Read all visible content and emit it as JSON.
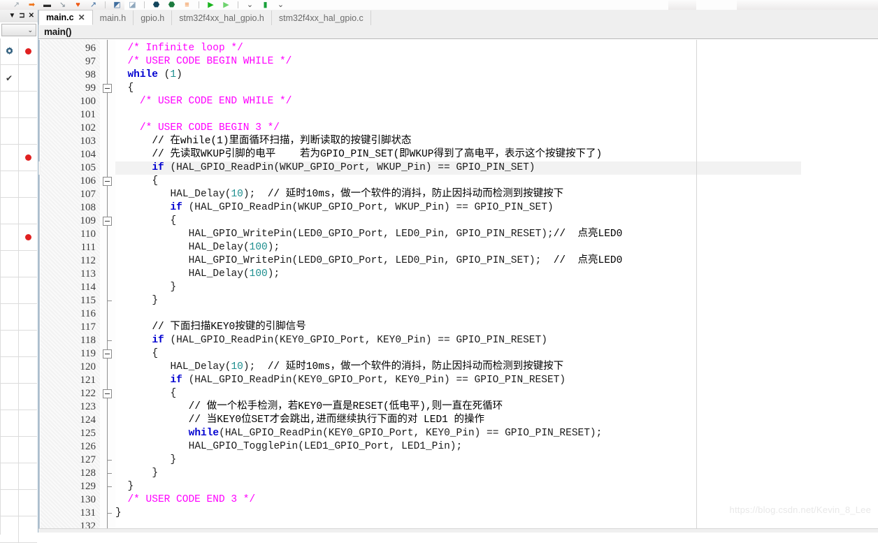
{
  "toolbar": {
    "icons": [
      {
        "name": "arrow-up-right-icon",
        "glyph": "↗",
        "color": "#9aa5ad"
      },
      {
        "name": "arrow-right-orange-icon",
        "glyph": "➡",
        "color": "#ef7216"
      },
      {
        "name": "step-over-icon",
        "glyph": "▬",
        "color": "#2b2b2b"
      },
      {
        "name": "arrow-down-left-icon",
        "glyph": "↘",
        "color": "#7d8a93"
      },
      {
        "name": "heart-orange-icon",
        "glyph": "♥",
        "color": "#ef5a16"
      },
      {
        "name": "arrow-up-right-blue-icon",
        "glyph": "↗",
        "color": "#3f6d9e"
      },
      {
        "name": "bookmark-box-icon",
        "glyph": "◩",
        "color": "#3f6d9e"
      },
      {
        "name": "bookmark-box2-icon",
        "glyph": "◪",
        "color": "#8fa7bd"
      },
      {
        "name": "shield-dark-icon",
        "glyph": "⬣",
        "color": "#12455c"
      },
      {
        "name": "shield-green-icon",
        "glyph": "⬣",
        "color": "#1b7a3e"
      },
      {
        "name": "list-orange-icon",
        "glyph": "≡",
        "color": "#ef7216"
      },
      {
        "name": "run-green-icon",
        "glyph": "▶",
        "color": "#18b31c"
      },
      {
        "name": "run-light-icon",
        "glyph": "▶",
        "color": "#6fd36f"
      },
      {
        "name": "overflow-chevron-icon",
        "glyph": "⌄",
        "color": "#4a4a4a"
      },
      {
        "name": "memory-green-icon",
        "glyph": "▮",
        "color": "#18a03a"
      },
      {
        "name": "overflow-chevron2-icon",
        "glyph": "⌄",
        "color": "#4a4a4a"
      }
    ]
  },
  "left_panel": {
    "header_buttons": [
      {
        "name": "panel-menu-icon",
        "glyph": "▼"
      },
      {
        "name": "panel-pin-icon",
        "glyph": "⊐"
      },
      {
        "name": "panel-close-icon",
        "glyph": "✕"
      }
    ],
    "dropdown": {
      "value": "",
      "chevron": "⌄"
    },
    "rows": [
      {
        "col1": "gear-icon",
        "col2": "breakpoint-dot"
      },
      {
        "col1": "check-icon",
        "col2": ""
      },
      {
        "col1": "",
        "col2": ""
      },
      {
        "col1": "",
        "col2": ""
      },
      {
        "col1": "",
        "col2": "breakpoint-dot"
      },
      {
        "col1": "",
        "col2": ""
      },
      {
        "col1": "",
        "col2": ""
      },
      {
        "col1": "",
        "col2": "breakpoint-dot"
      },
      {
        "col1": "",
        "col2": ""
      },
      {
        "col1": "",
        "col2": ""
      },
      {
        "col1": "",
        "col2": ""
      },
      {
        "col1": "",
        "col2": ""
      },
      {
        "col1": "",
        "col2": ""
      },
      {
        "col1": "",
        "col2": ""
      },
      {
        "col1": "",
        "col2": ""
      },
      {
        "col1": "",
        "col2": ""
      },
      {
        "col1": "",
        "col2": ""
      },
      {
        "col1": "",
        "col2": ""
      },
      {
        "col1": "",
        "col2": ""
      }
    ]
  },
  "tabs": [
    {
      "label": "main.c",
      "active": true,
      "close": "✕"
    },
    {
      "label": "main.h",
      "active": false
    },
    {
      "label": "gpio.h",
      "active": false
    },
    {
      "label": "stm32f4xx_hal_gpio.h",
      "active": false
    },
    {
      "label": "stm32f4xx_hal_gpio.c",
      "active": false
    }
  ],
  "scope": {
    "function": "main()"
  },
  "editor": {
    "first_line": 96,
    "current_line": 105,
    "fold_lines": [
      99,
      106,
      109,
      119,
      122
    ],
    "fold_ticks": [
      115,
      118,
      127,
      128,
      129,
      131
    ],
    "lines": [
      {
        "n": 96,
        "indent": 2,
        "tokens": [
          {
            "t": "/* Infinite loop */",
            "c": "cm"
          }
        ]
      },
      {
        "n": 97,
        "indent": 2,
        "tokens": [
          {
            "t": "/* USER CODE BEGIN WHILE */",
            "c": "cm"
          }
        ]
      },
      {
        "n": 98,
        "indent": 2,
        "tokens": [
          {
            "t": "while",
            "c": "kw"
          },
          {
            "t": " (",
            "c": "pn"
          },
          {
            "t": "1",
            "c": "num"
          },
          {
            "t": ")",
            "c": "pn"
          }
        ]
      },
      {
        "n": 99,
        "indent": 2,
        "tokens": [
          {
            "t": "{",
            "c": "pn"
          }
        ]
      },
      {
        "n": 100,
        "indent": 4,
        "tokens": [
          {
            "t": "/* USER CODE END WHILE */",
            "c": "cm"
          }
        ]
      },
      {
        "n": 101,
        "indent": 0,
        "tokens": []
      },
      {
        "n": 102,
        "indent": 4,
        "tokens": [
          {
            "t": "/* USER CODE BEGIN 3 */",
            "c": "cm"
          }
        ]
      },
      {
        "n": 103,
        "indent": 6,
        "tokens": [
          {
            "t": "// 在while(1)里面循环扫描，判断读取的按键引脚状态",
            "c": "cg"
          }
        ]
      },
      {
        "n": 104,
        "indent": 6,
        "tokens": [
          {
            "t": "// 先读取WKUP引脚的电平    若为GPIO_PIN_SET(即WKUP得到了高电平，表示这个按键按下了)",
            "c": "cg"
          }
        ]
      },
      {
        "n": 105,
        "indent": 6,
        "tokens": [
          {
            "t": "if",
            "c": "kw"
          },
          {
            "t": " (HAL_GPIO_ReadPin(WKUP_GPIO_Port, WKUP_Pin) == GPIO_PIN_SET)",
            "c": "id"
          }
        ]
      },
      {
        "n": 106,
        "indent": 6,
        "tokens": [
          {
            "t": "{",
            "c": "pn"
          }
        ]
      },
      {
        "n": 107,
        "indent": 9,
        "tokens": [
          {
            "t": "HAL_Delay(",
            "c": "id"
          },
          {
            "t": "10",
            "c": "num"
          },
          {
            "t": ");  ",
            "c": "id"
          },
          {
            "t": "// 延时10ms，做一个软件的消抖，防止因抖动而检测到按键按下",
            "c": "cg"
          }
        ]
      },
      {
        "n": 108,
        "indent": 9,
        "tokens": [
          {
            "t": "if",
            "c": "kw"
          },
          {
            "t": " (HAL_GPIO_ReadPin(WKUP_GPIO_Port, WKUP_Pin) == GPIO_PIN_SET)",
            "c": "id"
          }
        ]
      },
      {
        "n": 109,
        "indent": 9,
        "tokens": [
          {
            "t": "{",
            "c": "pn"
          }
        ]
      },
      {
        "n": 110,
        "indent": 12,
        "tokens": [
          {
            "t": "HAL_GPIO_WritePin(LED0_GPIO_Port, LED0_Pin, GPIO_PIN_RESET);",
            "c": "id"
          },
          {
            "t": "//  点亮LED0",
            "c": "cg"
          }
        ]
      },
      {
        "n": 111,
        "indent": 12,
        "tokens": [
          {
            "t": "HAL_Delay(",
            "c": "id"
          },
          {
            "t": "100",
            "c": "num"
          },
          {
            "t": ");",
            "c": "id"
          }
        ]
      },
      {
        "n": 112,
        "indent": 12,
        "tokens": [
          {
            "t": "HAL_GPIO_WritePin(LED0_GPIO_Port, LED0_Pin, GPIO_PIN_SET);  ",
            "c": "id"
          },
          {
            "t": "//  点亮LED0",
            "c": "cg"
          }
        ]
      },
      {
        "n": 113,
        "indent": 12,
        "tokens": [
          {
            "t": "HAL_Delay(",
            "c": "id"
          },
          {
            "t": "100",
            "c": "num"
          },
          {
            "t": ");",
            "c": "id"
          }
        ]
      },
      {
        "n": 114,
        "indent": 9,
        "tokens": [
          {
            "t": "}",
            "c": "pn"
          }
        ]
      },
      {
        "n": 115,
        "indent": 6,
        "tokens": [
          {
            "t": "}",
            "c": "pn"
          }
        ]
      },
      {
        "n": 116,
        "indent": 0,
        "tokens": []
      },
      {
        "n": 117,
        "indent": 6,
        "tokens": [
          {
            "t": "// 下面扫描KEY0按键的引脚信号",
            "c": "cg"
          }
        ]
      },
      {
        "n": 118,
        "indent": 6,
        "tokens": [
          {
            "t": "if",
            "c": "kw"
          },
          {
            "t": " (HAL_GPIO_ReadPin(KEY0_GPIO_Port, KEY0_Pin) == GPIO_PIN_RESET)",
            "c": "id"
          }
        ]
      },
      {
        "n": 119,
        "indent": 6,
        "tokens": [
          {
            "t": "{",
            "c": "pn"
          }
        ]
      },
      {
        "n": 120,
        "indent": 9,
        "tokens": [
          {
            "t": "HAL_Delay(",
            "c": "id"
          },
          {
            "t": "10",
            "c": "num"
          },
          {
            "t": ");  ",
            "c": "id"
          },
          {
            "t": "// 延时10ms，做一个软件的消抖，防止因抖动而检测到按键按下",
            "c": "cg"
          }
        ]
      },
      {
        "n": 121,
        "indent": 9,
        "tokens": [
          {
            "t": "if",
            "c": "kw"
          },
          {
            "t": " (HAL_GPIO_ReadPin(KEY0_GPIO_Port, KEY0_Pin) == GPIO_PIN_RESET)",
            "c": "id"
          }
        ]
      },
      {
        "n": 122,
        "indent": 9,
        "tokens": [
          {
            "t": "{",
            "c": "pn"
          }
        ]
      },
      {
        "n": 123,
        "indent": 12,
        "tokens": [
          {
            "t": "// 做一个松手检测，若KEY0一直是RESET(低电平),则一直在死循环",
            "c": "cg"
          }
        ]
      },
      {
        "n": 124,
        "indent": 12,
        "tokens": [
          {
            "t": "// 当KEY0位SET才会跳出,进而继续执行下面的对 LED1 的操作",
            "c": "cg"
          }
        ]
      },
      {
        "n": 125,
        "indent": 12,
        "tokens": [
          {
            "t": "while",
            "c": "kw"
          },
          {
            "t": "(HAL_GPIO_ReadPin(KEY0_GPIO_Port, KEY0_Pin) == GPIO_PIN_RESET);",
            "c": "id"
          }
        ]
      },
      {
        "n": 126,
        "indent": 12,
        "tokens": [
          {
            "t": "HAL_GPIO_TogglePin(LED1_GPIO_Port, LED1_Pin);",
            "c": "id"
          }
        ]
      },
      {
        "n": 127,
        "indent": 9,
        "tokens": [
          {
            "t": "}",
            "c": "pn"
          }
        ]
      },
      {
        "n": 128,
        "indent": 6,
        "tokens": [
          {
            "t": "}",
            "c": "pn"
          }
        ]
      },
      {
        "n": 129,
        "indent": 2,
        "tokens": [
          {
            "t": "}",
            "c": "pn"
          }
        ]
      },
      {
        "n": 130,
        "indent": 2,
        "tokens": [
          {
            "t": "/* USER CODE END 3 */",
            "c": "cm"
          }
        ]
      },
      {
        "n": 131,
        "indent": 0,
        "tokens": [
          {
            "t": "}",
            "c": "pn"
          }
        ]
      },
      {
        "n": 132,
        "indent": 0,
        "tokens": []
      }
    ]
  },
  "watermark": {
    "text": "https://blog.csdn.net/Kevin_8_Lee"
  },
  "colors": {
    "comment_block": "#ff00ff",
    "comment_line": "#1d8a4a",
    "keyword": "#0000d0",
    "number": "#1e8f8f",
    "identifier": "#1a1a1a",
    "breakpoint": "#e02020",
    "current_line_bg": "#f2f2f2",
    "tab_active_bg": "#ffffff",
    "panel_bg": "#efefef"
  }
}
